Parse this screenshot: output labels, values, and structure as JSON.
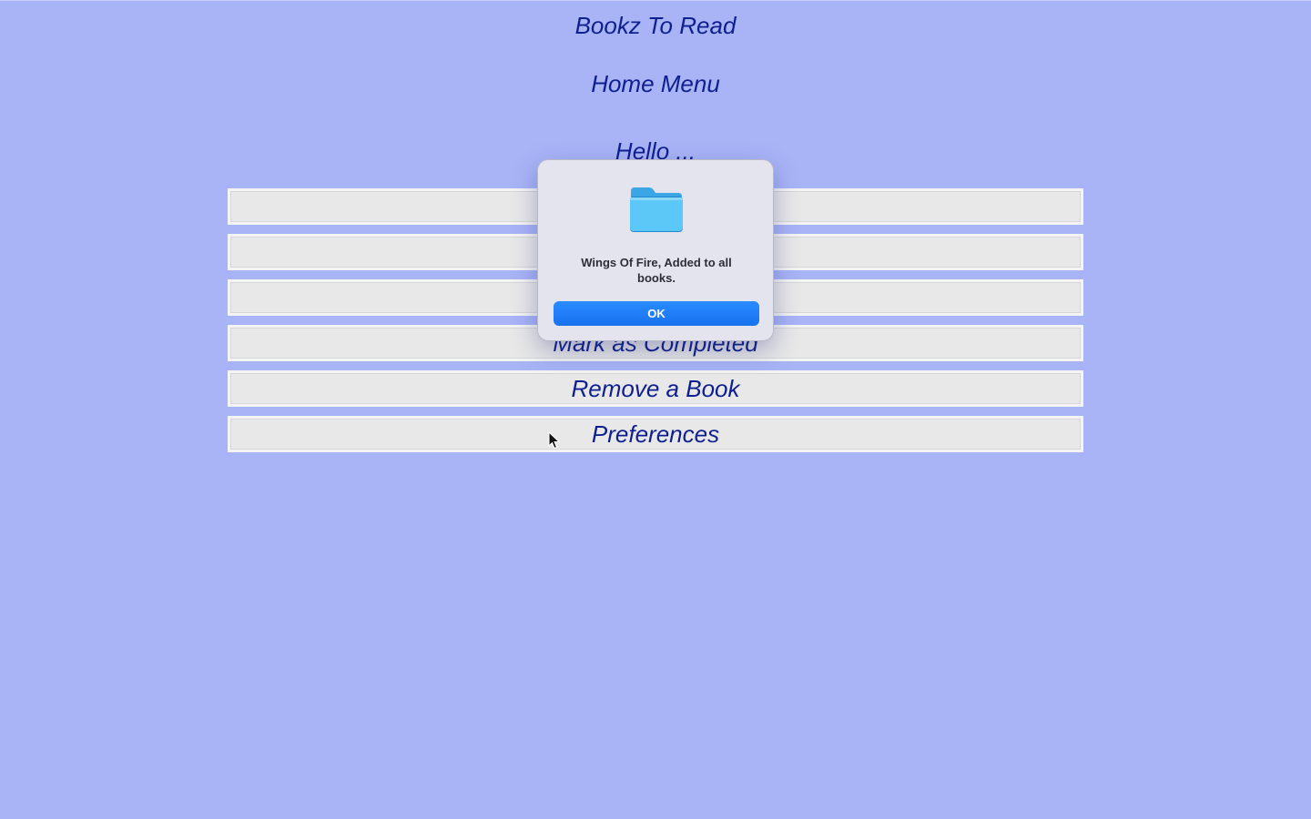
{
  "app": {
    "title": "Bookz To Read",
    "section_title": "Home Menu",
    "greeting": "Hello ..."
  },
  "menu": {
    "items": [
      {
        "label": ""
      },
      {
        "label": ""
      },
      {
        "label": ""
      },
      {
        "label": "Mark as Completed"
      },
      {
        "label": "Remove a Book"
      },
      {
        "label": "Preferences"
      }
    ]
  },
  "dialog": {
    "icon": "folder-icon",
    "message": "Wings Of Fire, Added to all books.",
    "ok_label": "OK"
  },
  "colors": {
    "background": "#a9b4f7",
    "text": "#0f1f8f",
    "button_face": "#e8e8e8",
    "ok_button": "#1f80f8"
  }
}
